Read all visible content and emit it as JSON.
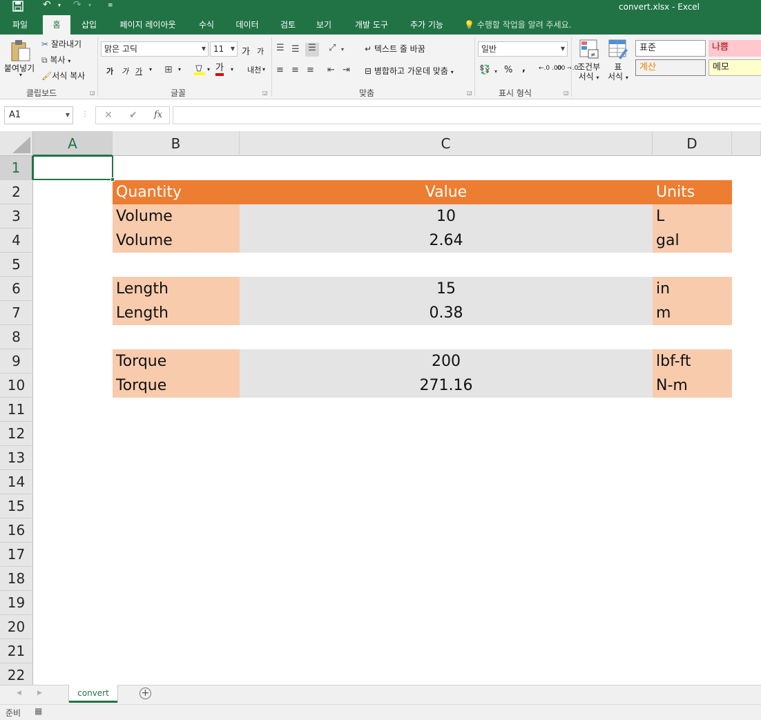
{
  "title_bar": {
    "document_title": "convert.xlsx - Excel"
  },
  "ribbon_tabs": [
    "파일",
    "홈",
    "삽입",
    "페이지 레이아웃",
    "수식",
    "데이터",
    "검토",
    "보기",
    "개발 도구",
    "추가 기능"
  ],
  "active_tab": "홈",
  "tell_me": "수행할 작업을 알려 주세요.",
  "clipboard": {
    "paste": "붙여넣기",
    "cut": "잘라내기",
    "copy": "복사",
    "format_painter": "서식 복사",
    "label": "클립보드"
  },
  "font": {
    "name": "맑은 고딕",
    "size": "11",
    "increase": "가",
    "decrease": "가",
    "bold": "가",
    "italic": "가",
    "underline": "가",
    "font_color": "가",
    "phonetic": "내천",
    "label": "글꼴"
  },
  "alignment": {
    "wrap_text": "텍스트 줄 바꿈",
    "merge_center": "병합하고 가운데 맞춤",
    "label": "맞춤"
  },
  "number": {
    "format": "일반",
    "percent": "%",
    "comma": ",",
    "inc_decimal": "←.0 .00",
    "dec_decimal": ".00 →.0",
    "label": "표시 형식"
  },
  "styles": {
    "conditional_line1": "조건부",
    "conditional_line2": "서식",
    "table_line1": "표",
    "table_line2": "서식",
    "normal": "표준",
    "bad": "나쁨",
    "calculation": "계산",
    "note": "메모"
  },
  "formula_bar": {
    "name_box": "A1",
    "fx": "fx",
    "content": ""
  },
  "columns": [
    "A",
    "B",
    "C",
    "D"
  ],
  "rows": [
    "1",
    "2",
    "3",
    "4",
    "5",
    "6",
    "7",
    "8",
    "9",
    "10",
    "11",
    "12",
    "13",
    "14",
    "15",
    "16",
    "17",
    "18",
    "19",
    "20",
    "21",
    "22"
  ],
  "table": {
    "header": {
      "quantity": "Quantity",
      "value": "Value",
      "units": "Units"
    },
    "r3": {
      "quantity": "Volume",
      "value": "10",
      "units": "L"
    },
    "r4": {
      "quantity": "Volume",
      "value": "2.64",
      "units": "gal"
    },
    "r6": {
      "quantity": "Length",
      "value": "15",
      "units": "in"
    },
    "r7": {
      "quantity": "Length",
      "value": "0.38",
      "units": "m"
    },
    "r9": {
      "quantity": "Torque",
      "value": "200",
      "units": "lbf-ft"
    },
    "r10": {
      "quantity": "Torque",
      "value": "271.16",
      "units": "N-m"
    }
  },
  "sheet_tab": "convert",
  "status": "준비",
  "colors": {
    "excel_green": "#217346",
    "header_orange": "#ed7d31",
    "light_orange": "#f8cbad",
    "value_gray": "#e4e4e4"
  }
}
